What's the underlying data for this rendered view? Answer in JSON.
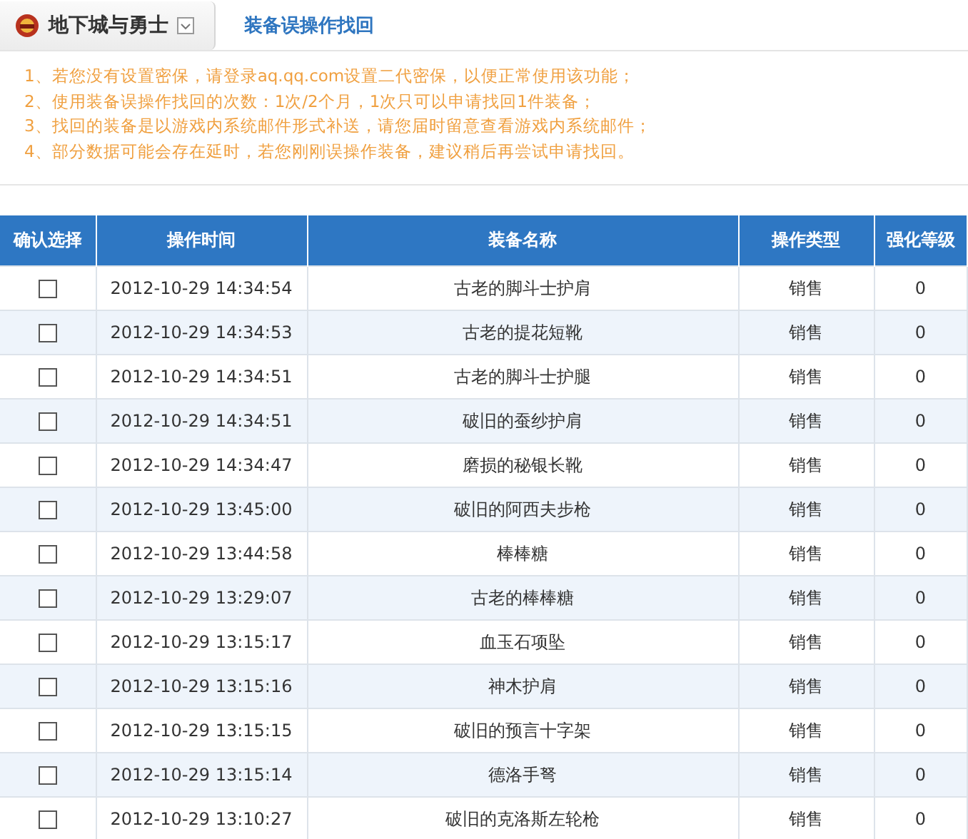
{
  "header": {
    "game": "地下城与勇士",
    "title": "装备误操作找回"
  },
  "notes": [
    "1、若您没有设置密保，请登录aq.qq.com设置二代密保，以便正常使用该功能；",
    "2、使用装备误操作找回的次数：1次/2个月，1次只可以申请找回1件装备；",
    "3、找回的装备是以游戏内系统邮件形式补送，请您届时留意查看游戏内系统邮件；",
    "4、部分数据可能会存在延时，若您刚刚误操作装备，建议稍后再尝试申请找回。"
  ],
  "table": {
    "columns": [
      "确认选择",
      "操作时间",
      "装备名称",
      "操作类型",
      "强化等级"
    ],
    "rows": [
      {
        "checked": false,
        "time": "2012-10-29 14:34:54",
        "name": "古老的脚斗士护肩",
        "type": "销售",
        "level": "0"
      },
      {
        "checked": false,
        "time": "2012-10-29 14:34:53",
        "name": "古老的提花短靴",
        "type": "销售",
        "level": "0"
      },
      {
        "checked": false,
        "time": "2012-10-29 14:34:51",
        "name": "古老的脚斗士护腿",
        "type": "销售",
        "level": "0"
      },
      {
        "checked": false,
        "time": "2012-10-29 14:34:51",
        "name": "破旧的蚕纱护肩",
        "type": "销售",
        "level": "0"
      },
      {
        "checked": false,
        "time": "2012-10-29 14:34:47",
        "name": "磨损的秘银长靴",
        "type": "销售",
        "level": "0"
      },
      {
        "checked": false,
        "time": "2012-10-29 13:45:00",
        "name": "破旧的阿西夫步枪",
        "type": "销售",
        "level": "0"
      },
      {
        "checked": false,
        "time": "2012-10-29 13:44:58",
        "name": "棒棒糖",
        "type": "销售",
        "level": "0"
      },
      {
        "checked": false,
        "time": "2012-10-29 13:29:07",
        "name": "古老的棒棒糖",
        "type": "销售",
        "level": "0"
      },
      {
        "checked": false,
        "time": "2012-10-29 13:15:17",
        "name": "血玉石项坠",
        "type": "销售",
        "level": "0"
      },
      {
        "checked": false,
        "time": "2012-10-29 13:15:16",
        "name": "神木护肩",
        "type": "销售",
        "level": "0"
      },
      {
        "checked": false,
        "time": "2012-10-29 13:15:15",
        "name": "破旧的预言十字架",
        "type": "销售",
        "level": "0"
      },
      {
        "checked": false,
        "time": "2012-10-29 13:15:14",
        "name": "德洛手弩",
        "type": "销售",
        "level": "0"
      },
      {
        "checked": false,
        "time": "2012-10-29 13:10:27",
        "name": "破旧的克洛斯左轮枪",
        "type": "销售",
        "level": "0"
      }
    ]
  }
}
